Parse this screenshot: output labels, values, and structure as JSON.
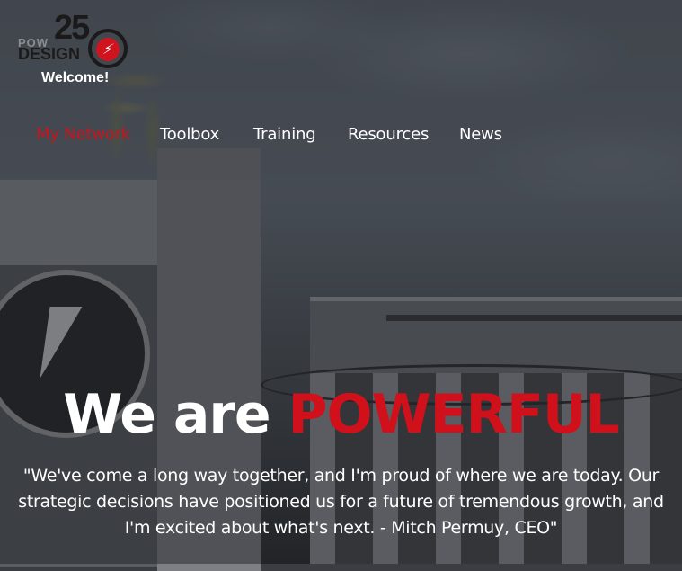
{
  "brand": {
    "logo_number": "25",
    "logo_word_top": "POW",
    "logo_word_bottom": "DESIGN",
    "accent_color": "#d0111b"
  },
  "header": {
    "welcome": "Welcome!"
  },
  "nav": {
    "items": [
      {
        "label": "My Network",
        "active": true
      },
      {
        "label": "Toolbox",
        "active": false
      },
      {
        "label": "Training",
        "active": false
      },
      {
        "label": "Resources",
        "active": false
      },
      {
        "label": "News",
        "active": false
      }
    ]
  },
  "hero": {
    "title_plain": "We are ",
    "title_accent": "POWERFUL",
    "quote": "\"We've come a long way together, and I'm proud of where we are today. Our strategic decisions have positioned us for a future of tremendous growth, and I'm excited about what's next. - Mitch Permuy, CEO\""
  }
}
